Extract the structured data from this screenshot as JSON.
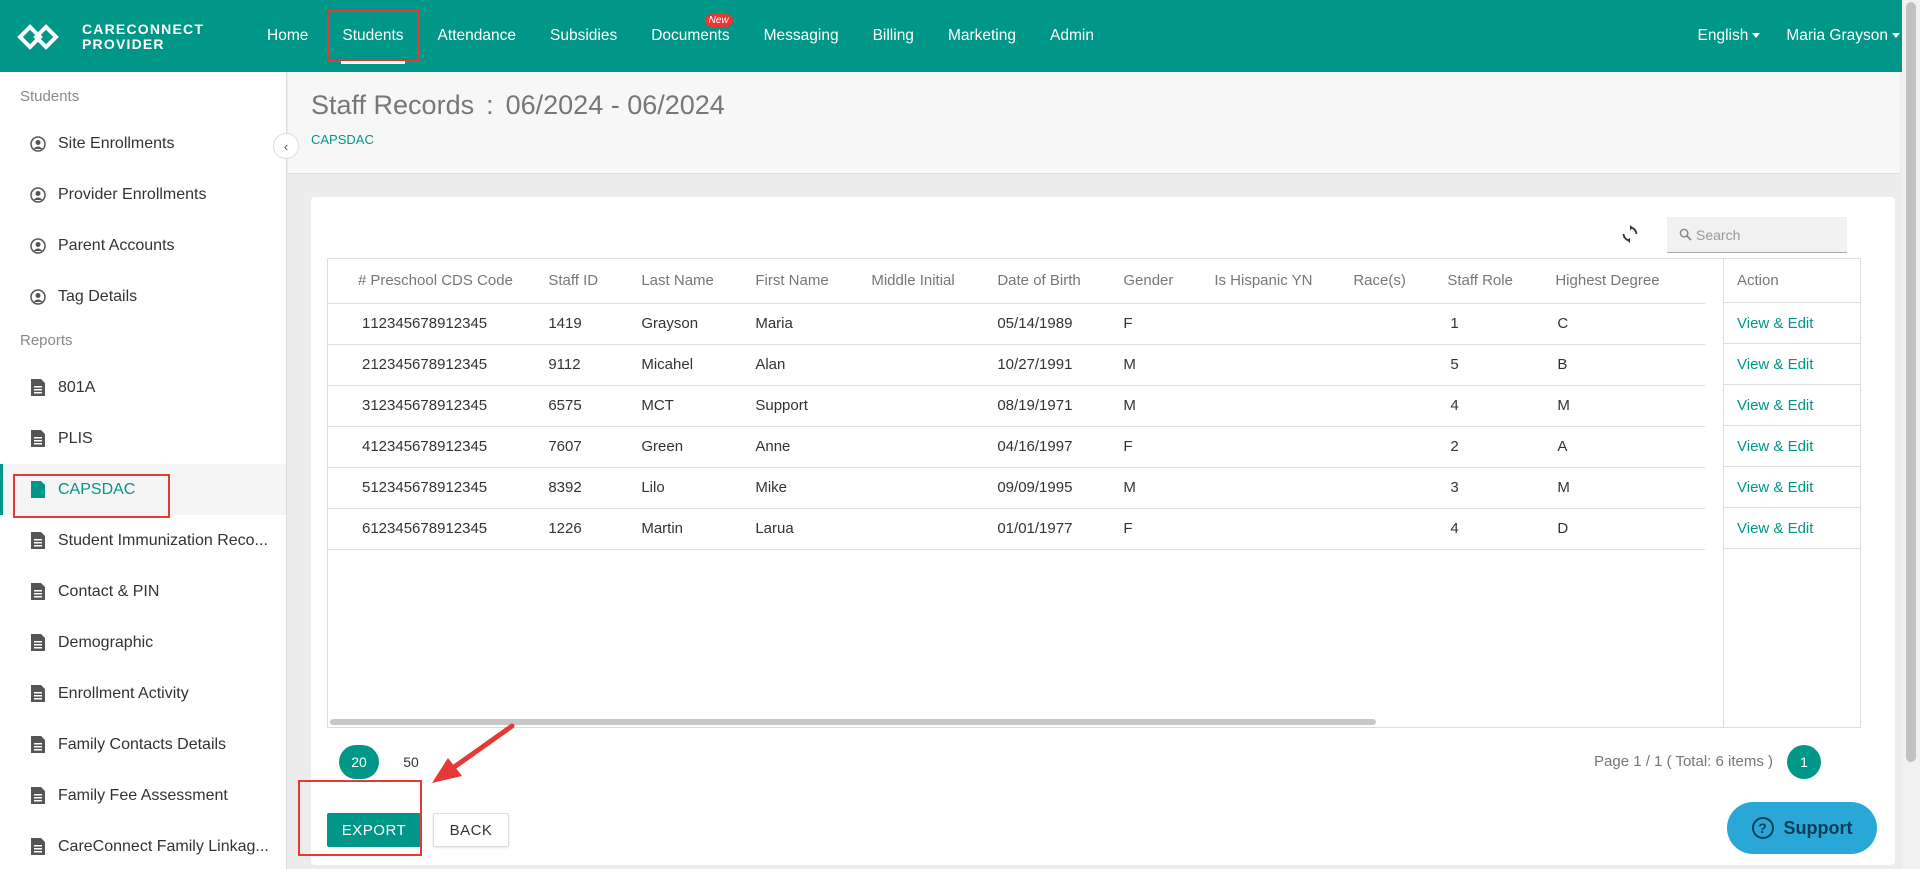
{
  "brand": {
    "line1": "CARECONNECT",
    "line2": "PROVIDER"
  },
  "nav": {
    "items": [
      "Home",
      "Students",
      "Attendance",
      "Subsidies",
      "Documents",
      "Messaging",
      "Billing",
      "Marketing",
      "Admin"
    ],
    "new_badge": "New",
    "language": "English",
    "user": "Maria Grayson"
  },
  "sidebar": {
    "section_students": "Students",
    "students_items": [
      "Site Enrollments",
      "Provider Enrollments",
      "Parent Accounts",
      "Tag Details"
    ],
    "section_reports": "Reports",
    "reports_items": [
      "801A",
      "PLIS",
      "CAPSDAC",
      "Student Immunization Reco...",
      "Contact & PIN",
      "Demographic",
      "Enrollment Activity",
      "Family Contacts Details",
      "Family Fee Assessment",
      "CareConnect Family Linkag..."
    ]
  },
  "page": {
    "title": "Staff Records",
    "colon": ":",
    "period": "06/2024 - 06/2024",
    "breadcrumb": "CAPSDAC"
  },
  "search": {
    "placeholder": "Search"
  },
  "table": {
    "headers": [
      "#",
      "Preschool CDS Code",
      "Staff ID",
      "Last Name",
      "First Name",
      "Middle Initial",
      "Date of Birth",
      "Gender",
      "Is Hispanic YN",
      "Race(s)",
      "Staff Role",
      "Highest Degree"
    ],
    "action_header": "Action",
    "action_label": "View & Edit",
    "rows": [
      [
        "1",
        "12345678912345",
        "1419",
        "Grayson",
        "Maria",
        "",
        "05/14/1989",
        "F",
        "",
        "",
        "1",
        "C"
      ],
      [
        "2",
        "12345678912345",
        "9112",
        "Micahel",
        "Alan",
        "",
        "10/27/1991",
        "M",
        "",
        "",
        "5",
        "B"
      ],
      [
        "3",
        "12345678912345",
        "6575",
        "MCT",
        "Support",
        "",
        "08/19/1971",
        "M",
        "",
        "",
        "4",
        "M"
      ],
      [
        "4",
        "12345678912345",
        "7607",
        "Green",
        "Anne",
        "",
        "04/16/1997",
        "F",
        "",
        "",
        "2",
        "A"
      ],
      [
        "5",
        "12345678912345",
        "8392",
        "Lilo",
        "Mike",
        "",
        "09/09/1995",
        "M",
        "",
        "",
        "3",
        "M"
      ],
      [
        "6",
        "12345678912345",
        "1226",
        "Martin",
        "Larua",
        "",
        "01/01/1977",
        "F",
        "",
        "",
        "4",
        "D"
      ]
    ]
  },
  "pager": {
    "sizes": [
      "20",
      "50"
    ],
    "info": "Page 1 / 1 ( Total: 6 items )",
    "current": "1"
  },
  "buttons": {
    "export": "EXPORT",
    "back": "BACK"
  },
  "support": {
    "label": "Support",
    "icon": "?"
  },
  "colors": {
    "primary": "#009688",
    "highlight": "#e53935",
    "support": "#29a8d8"
  }
}
